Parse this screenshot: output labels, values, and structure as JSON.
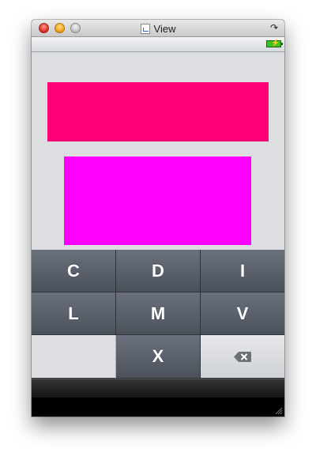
{
  "window": {
    "title": "View"
  },
  "keypad": {
    "keys": [
      {
        "label": "C"
      },
      {
        "label": "D"
      },
      {
        "label": "I"
      },
      {
        "label": "L"
      },
      {
        "label": "M"
      },
      {
        "label": "V"
      },
      {
        "label": ""
      },
      {
        "label": "X"
      },
      {
        "label": "",
        "icon": "delete-icon"
      }
    ]
  },
  "colors": {
    "rect_top": "#ff0077",
    "rect_bottom": "#ff00ff",
    "battery": "#3fc31f"
  }
}
